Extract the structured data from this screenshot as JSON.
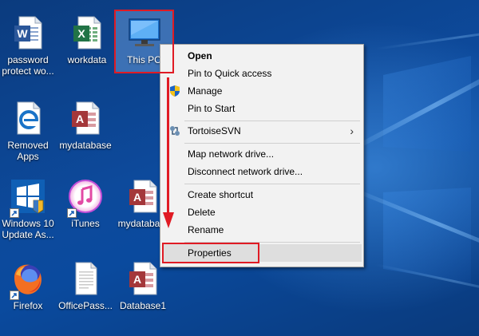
{
  "desktop": {
    "icons": [
      {
        "label": "password protect wo...",
        "icon": "word-doc-icon"
      },
      {
        "label": "workdata",
        "icon": "excel-sheet-icon"
      },
      {
        "label": "This PC",
        "icon": "monitor-icon",
        "selected": true
      },
      {
        "label": "Removed Apps",
        "icon": "edge-html-icon"
      },
      {
        "label": "mydatabase",
        "icon": "access-db-icon"
      },
      {
        "label": "Windows 10 Update As...",
        "icon": "windows-logo-icon",
        "shortcut": true
      },
      {
        "label": "iTunes",
        "icon": "itunes-icon",
        "shortcut": true
      },
      {
        "label": "mydataba...",
        "icon": "access-db-icon"
      },
      {
        "label": "Firefox",
        "icon": "firefox-icon",
        "shortcut": true
      },
      {
        "label": "OfficePass...",
        "icon": "blank-document-icon"
      },
      {
        "label": "Database1",
        "icon": "access-db-icon"
      }
    ]
  },
  "context_menu": {
    "items": [
      {
        "label": "Open",
        "bold": true
      },
      {
        "label": "Pin to Quick access"
      },
      {
        "label": "Manage",
        "icon": "uac-shield-icon"
      },
      {
        "label": "Pin to Start"
      },
      {
        "label": "TortoiseSVN",
        "icon": "tortoisesvn-icon",
        "submenu": true
      },
      {
        "label": "Map network drive..."
      },
      {
        "label": "Disconnect network drive..."
      },
      {
        "label": "Create shortcut"
      },
      {
        "label": "Delete"
      },
      {
        "label": "Rename"
      },
      {
        "label": "Properties",
        "highlighted": true
      }
    ],
    "submenu_glyph": "›"
  },
  "annotations": {
    "color": "#e01b24"
  },
  "colors": {
    "wallpaper_blue": "#0a3f86",
    "menu_background": "#f2f2f2",
    "selection": "#78aae6"
  }
}
